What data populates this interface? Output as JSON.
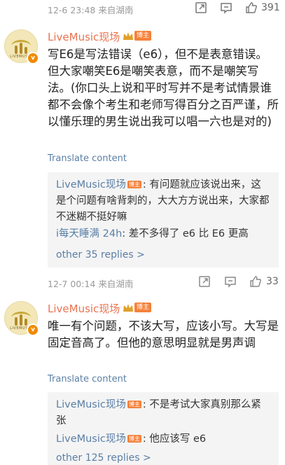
{
  "top_meta": {
    "time": "12-6 23:48 来自湖南",
    "likes": "391"
  },
  "comments": [
    {
      "username": "LiveMusic现场",
      "tag": "博主",
      "avatar_text": "LIVEMUSIC",
      "text": "写E6是写法错误（e6），但不是表意错误。但大家嘲笑E6是嘲笑表意，而不是嘲笑写法。(你口头上说和平时写并不是考试情景谁都不会像个考生和老师写得百分之百严谨，所以懂乐理的男生说出我可以唱一六也是对的)",
      "translate": "Translate content",
      "replies": [
        {
          "name": "LiveMusic现场",
          "tag": "博主",
          "text": ": 有问题就应该说出来，这是个问题有啥背刺的，大大方方说出来，大家都不迷糊不挺好嘛"
        },
        {
          "name": "i每天睡满 24h",
          "text": ": 差不多得了 e6 比 E6 更高"
        }
      ],
      "more": "other 35 replies >",
      "time": "12-7 00:14 来自湖南",
      "likes": "33"
    },
    {
      "username": "LiveMusic现场",
      "tag": "博主",
      "avatar_text": "LIVEMUSIC",
      "text": "唯一有个问题，不该大写，应该小写。大写是固定音高了。但他的意思明显就是男声调",
      "translate": "Translate content",
      "replies": [
        {
          "name": "LiveMusic现场",
          "tag": "博主",
          "text": ": 不是考试大家真别那么紧张"
        },
        {
          "name": "LiveMusic现场",
          "tag": "博主",
          "text": ": 他应该写 e6"
        }
      ],
      "more": "other 125 replies >"
    }
  ],
  "colors": {
    "username": "#eb7350",
    "link": "#5a7fa6",
    "tag_bg": "#f5813b",
    "meta": "#9a9a9a"
  },
  "icons": [
    "share-icon",
    "comment-icon",
    "like-icon",
    "crown-icon",
    "verified-icon"
  ]
}
